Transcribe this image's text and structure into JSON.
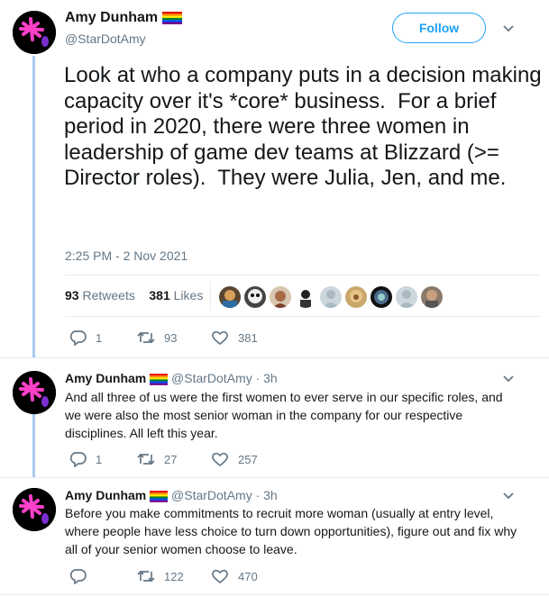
{
  "main_tweet": {
    "display_name": "Amy Dunham",
    "handle": "@StarDotAmy",
    "follow_label": "Follow",
    "text": "Look at who a company puts in a decision making capacity over it's *core* business.  For a brief period in 2020, there were three women in leadership of game dev teams at Blizzard (>= Director roles).  They were Julia, Jen, and me.",
    "timestamp": "2:25 PM - 2 Nov 2021",
    "retweets_count": "93",
    "retweets_label": "Retweets",
    "likes_count": "381",
    "likes_label": "Likes",
    "actions": {
      "replies": "1",
      "retweets": "93",
      "likes": "381"
    }
  },
  "replies": [
    {
      "display_name": "Amy Dunham",
      "handle": "@StarDotAmy",
      "time": "· 3h",
      "text": "And all three of us were the first women to ever serve in our specific roles, and we were also the most senior woman in the company for our respective disciplines.  All left this year.",
      "actions": {
        "replies": "1",
        "retweets": "27",
        "likes": "257"
      }
    },
    {
      "display_name": "Amy Dunham",
      "handle": "@StarDotAmy",
      "time": "· 3h",
      "text": "Before you make commitments to recruit more woman (usually at entry level, where people have less choice to turn down opportunities), figure out and fix why all of your senior women choose to leave.",
      "actions": {
        "replies": "",
        "retweets": "122",
        "likes": "470"
      }
    }
  ],
  "icons": {
    "reply": "reply-icon",
    "retweet": "retweet-icon",
    "like": "heart-icon",
    "caret": "chevron-down-icon",
    "flag": "rainbow-flag-icon"
  },
  "colors": {
    "accent": "#1da1f2",
    "thread_line": "#a7ccee",
    "secondary_text": "#657786",
    "avatar_star": "#ff40c8",
    "avatar_drop": "#7b2fd0"
  }
}
